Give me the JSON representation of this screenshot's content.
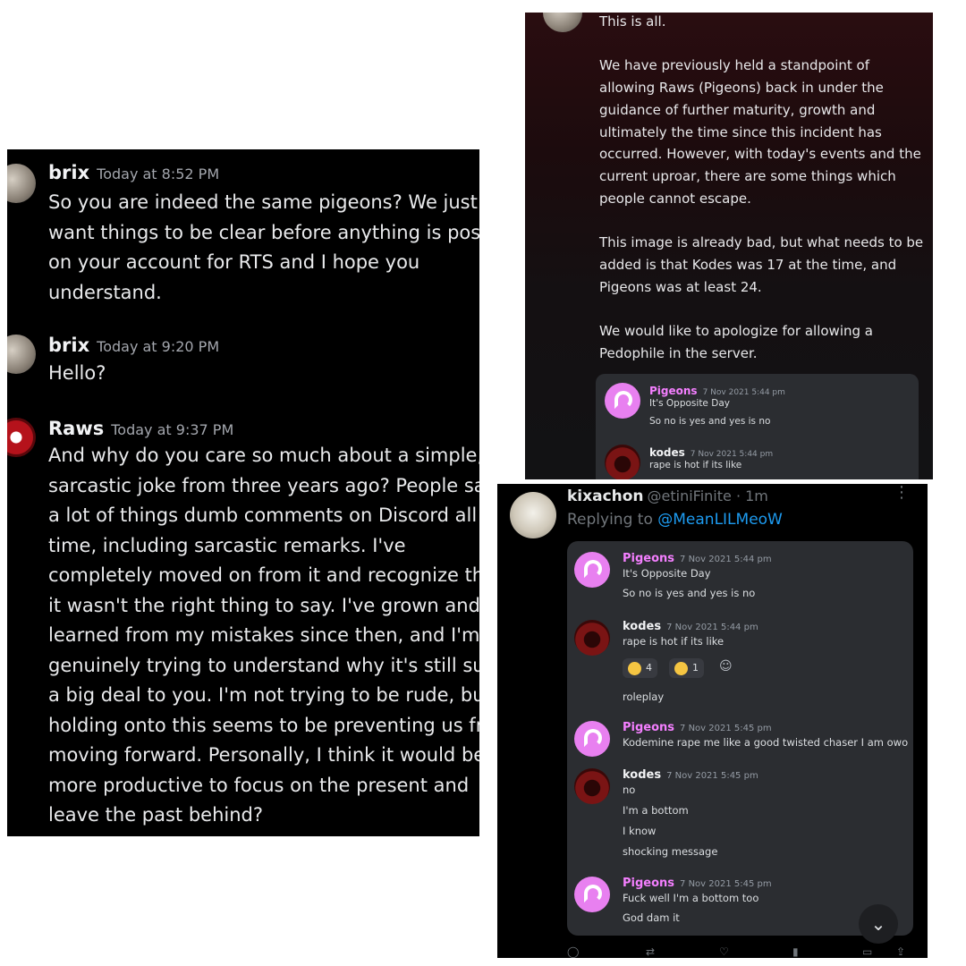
{
  "left_chat": {
    "messages": [
      {
        "user": "brix",
        "time": "Today at 8:52 PM",
        "lines": [
          "So you are indeed the same pigeons? We just",
          "want things to be clear before anything is poste",
          "on your account for RTS and I hope you",
          "understand."
        ]
      },
      {
        "user": "brix",
        "time": "Today at 9:20 PM",
        "lines": [
          "Hello?"
        ]
      },
      {
        "user": "Raws",
        "time": "Today at 9:37 PM",
        "lines": [
          "And why do you care so much about a simple,",
          "sarcastic joke from three years ago? People say",
          "a lot of things dumb comments on Discord all th",
          "time, including sarcastic remarks. I've",
          "completely moved on from it and recognize that",
          "it wasn't the right thing to say. I've grown and",
          "learned from my mistakes since then, and I'm",
          "genuinely trying to understand why it's still such",
          "a big deal to you. I'm not trying to be rude, but",
          "holding onto this seems to be preventing us fron",
          "moving forward. Personally, I think it would be",
          "more productive to focus on the present and",
          "leave the past behind?"
        ]
      }
    ]
  },
  "announcement": {
    "lines": [
      "This is all.",
      "We have previously held a standpoint of",
      "allowing Raws (Pigeons) back in under the",
      "guidance of further maturity, growth and",
      "ultimately the time since this incident has",
      "occurred. However, with today's events and the",
      "current uproar, there are some things which",
      "people cannot escape.",
      "This image is already bad, but what needs to be",
      "added is that Kodes was 17 at the time, and",
      "Pigeons was at least 24.",
      "We would like to apologize for allowing a",
      "Pedophile in the server."
    ],
    "quote": [
      {
        "user": "Pigeons",
        "time": "7 Nov 2021 5:44 pm",
        "lines": [
          "It's Opposite Day",
          "So no is yes and yes is no"
        ]
      },
      {
        "user": "kodes",
        "time": "7 Nov 2021 5:44 pm",
        "lines": [
          "rape is hot if its like"
        ]
      }
    ]
  },
  "tweet": {
    "name": "kixachon",
    "handle": "@etiniFinite · 1m",
    "replying_prefix": "Replying to",
    "replying_to": "@MeanLILMeoW",
    "more_icon": "⋮",
    "messages": [
      {
        "user": "Pigeons",
        "time": "7 Nov 2021 5:44 pm",
        "lines": [
          "It's Opposite Day",
          "So no is yes and yes is no"
        ]
      },
      {
        "user": "kodes",
        "time": "7 Nov 2021 5:44 pm",
        "lines": [
          "rape is hot if its like"
        ]
      },
      {
        "user": "Pigeons",
        "time": "7 Nov 2021 5:45 pm",
        "lines": [
          "Kodemine rape me like a good twisted chaser I am owo"
        ]
      },
      {
        "user": "kodes",
        "time": "7 Nov 2021 5:45 pm",
        "lines": [
          "no",
          "I'm a bottom",
          "I know",
          "shocking message"
        ]
      },
      {
        "user": "Pigeons",
        "time": "7 Nov 2021 5:45 pm",
        "lines": [
          "Fuck well I'm a bottom too",
          "God dam it"
        ]
      }
    ],
    "reactions": [
      {
        "icon": "neutral-face-emoji",
        "count": "4"
      },
      {
        "icon": "thinking-face-emoji",
        "count": "1"
      }
    ],
    "roleplay": "roleplay",
    "scroll_icon": "⌄"
  }
}
